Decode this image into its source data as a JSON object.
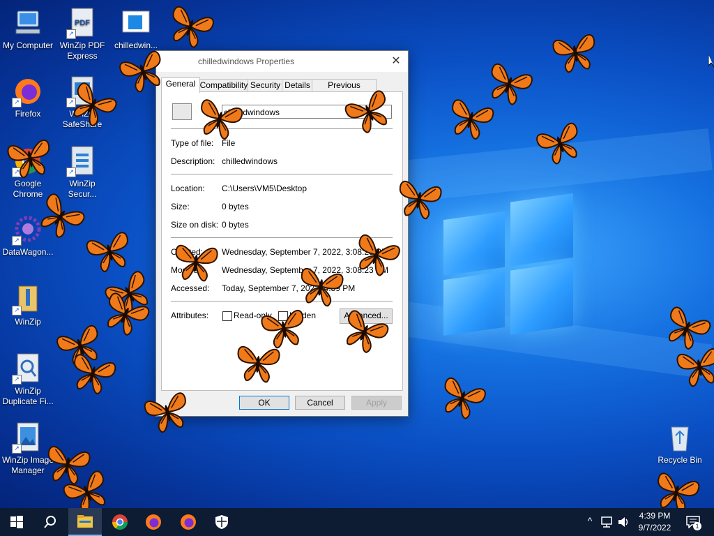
{
  "desktop_icons": [
    {
      "label": "My Computer",
      "icon": "computer-icon"
    },
    {
      "label": "WinZip PDF Express",
      "icon": "pdf-icon"
    },
    {
      "label": "chilledwin...",
      "icon": "window-file-icon"
    },
    {
      "label": "Firefox",
      "icon": "firefox-icon"
    },
    {
      "label": "WinZip SafeShare",
      "icon": "safeshare-icon"
    },
    {
      "label": "Google Chrome",
      "icon": "chrome-icon"
    },
    {
      "label": "WinZip Secur...",
      "icon": "winzip-secure-icon"
    },
    {
      "label": "DataWagon...",
      "icon": "datawagon-icon"
    },
    {
      "label": "WinZip",
      "icon": "winzip-icon"
    },
    {
      "label": "WinZip Duplicate Fi...",
      "icon": "duplicate-finder-icon"
    },
    {
      "label": "WinZip Image Manager",
      "icon": "image-manager-icon"
    },
    {
      "label": "Recycle Bin",
      "icon": "recycle-bin-icon"
    }
  ],
  "dialog": {
    "title": "chilledwindows Properties",
    "close_glyph": "✕",
    "tabs": [
      "General",
      "Compatibility",
      "Security",
      "Details",
      "Previous Versions"
    ],
    "active_tab": "General",
    "name_value": "chilledwindows",
    "fields": {
      "type_label": "Type of file:",
      "type_value": "File",
      "description_label": "Description:",
      "description_value": "chilledwindows",
      "location_label": "Location:",
      "location_value": "C:\\Users\\VM5\\Desktop",
      "size_label": "Size:",
      "size_value": "0 bytes",
      "size_on_disk_label": "Size on disk:",
      "size_on_disk_value": "0 bytes",
      "created_label": "Created:",
      "created_value": "Wednesday, September 7, 2022, 3:08:23 PM",
      "modified_label": "Modified:",
      "modified_value": "Wednesday, September 7, 2022, 3:08:23 PM",
      "accessed_label": "Accessed:",
      "accessed_value": "Today, September 7, 2022, 4:39 PM",
      "attributes_label": "Attributes:",
      "readonly_label": "Read-only",
      "hidden_label": "Hidden",
      "advanced_label": "Advanced..."
    },
    "buttons": {
      "ok": "OK",
      "cancel": "Cancel",
      "apply": "Apply"
    }
  },
  "taskbar": {
    "start_icon": "windows-start-icon",
    "search_icon": "search-icon",
    "pinned": [
      "file-explorer-icon",
      "chrome-icon",
      "firefox-icon",
      "firefox-icon",
      "security-shield-icon"
    ],
    "tray": {
      "chevron": "^",
      "time": "4:39 PM",
      "date": "9/7/2022",
      "notification_count": "1"
    }
  },
  "colors": {
    "taskbar": "#0d1b33",
    "butterfly_orange": "#f07a1a",
    "accent": "#0078d7"
  }
}
